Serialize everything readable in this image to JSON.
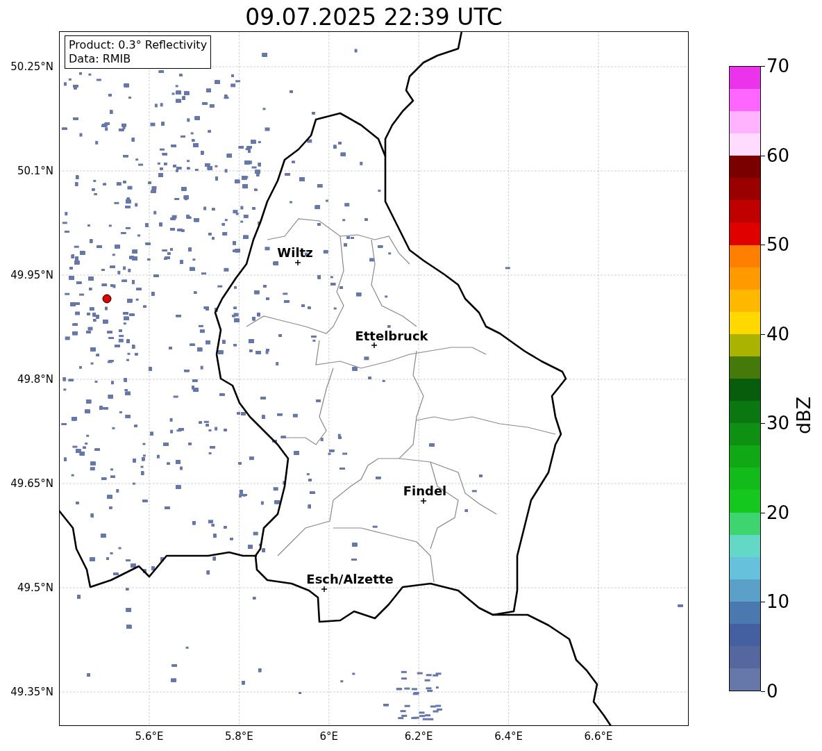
{
  "title": "09.07.2025 22:39 UTC",
  "info_box": {
    "lines": [
      "Product: 0.3° Reflectivity",
      "Data: RMIB"
    ]
  },
  "lat_ticks": [
    "50.25°N",
    "50.1°N",
    "49.95°N",
    "49.8°N",
    "49.65°N",
    "49.5°N",
    "49.35°N"
  ],
  "lon_ticks": [
    "5.6°E",
    "5.8°E",
    "6°E",
    "6.2°E",
    "6.4°E",
    "6.6°E"
  ],
  "cities": [
    {
      "name": "Wiltz"
    },
    {
      "name": "Ettelbruck"
    },
    {
      "name": "Findel"
    },
    {
      "name": "Esch/Alzette"
    }
  ],
  "colorbar": {
    "label": "dBZ",
    "ticks": [
      "70",
      "60",
      "50",
      "40",
      "30",
      "20",
      "10",
      "0"
    ],
    "steps": [
      {
        "color": "#ea33ea"
      },
      {
        "color": "#ff66ff"
      },
      {
        "color": "#ffb3ff"
      },
      {
        "color": "#ffdcff"
      },
      {
        "color": "#7a0000"
      },
      {
        "color": "#9a0000"
      },
      {
        "color": "#c00000"
      },
      {
        "color": "#e00000"
      },
      {
        "color": "#ff7f00"
      },
      {
        "color": "#ff9a00"
      },
      {
        "color": "#ffb800"
      },
      {
        "color": "#ffd800"
      },
      {
        "color": "#aab300"
      },
      {
        "color": "#457a0a"
      },
      {
        "color": "#085d0c"
      },
      {
        "color": "#0b7710"
      },
      {
        "color": "#0e9012"
      },
      {
        "color": "#10a815"
      },
      {
        "color": "#12bb1a"
      },
      {
        "color": "#14c81e"
      },
      {
        "color": "#3ed470"
      },
      {
        "color": "#64d8c6"
      },
      {
        "color": "#66c2dc"
      },
      {
        "color": "#5aa0c8"
      },
      {
        "color": "#4a79b0"
      },
      {
        "color": "#4560a0"
      },
      {
        "color": "#5667a0"
      },
      {
        "color": "#6677a9"
      }
    ]
  }
}
